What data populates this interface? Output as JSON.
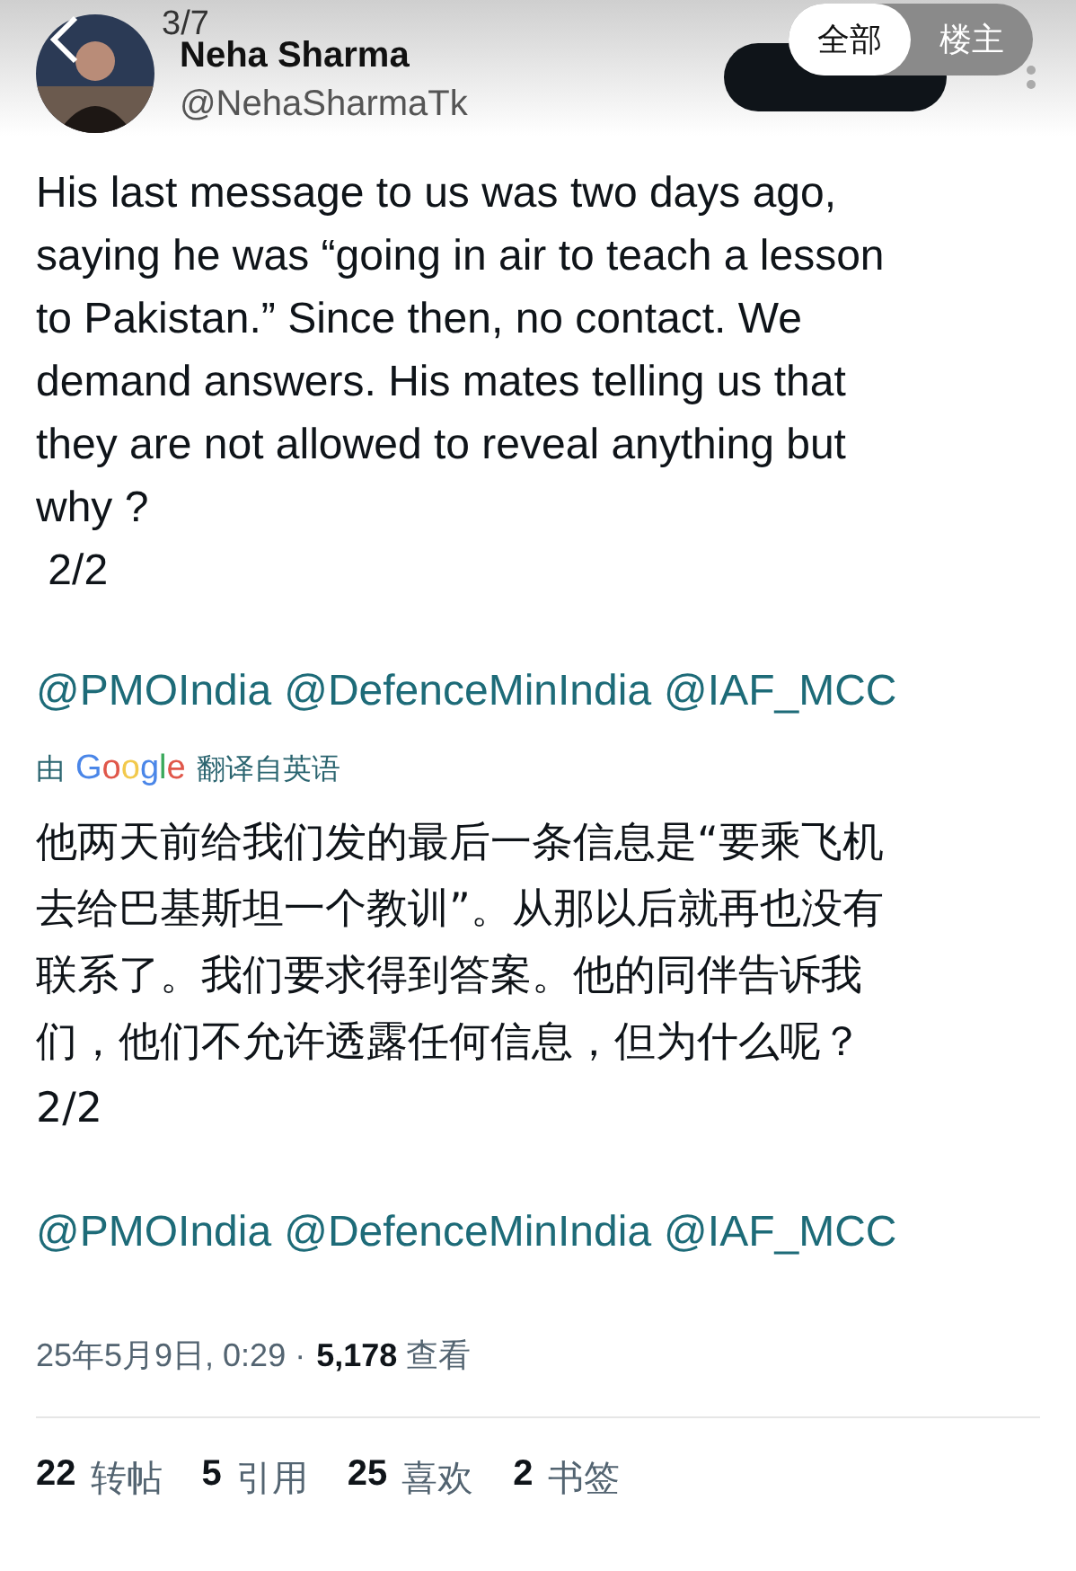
{
  "viewer": {
    "page_counter": "3/7",
    "filter_tabs": [
      {
        "label": "全部",
        "selected": true
      },
      {
        "label": "楼主",
        "selected": false
      }
    ]
  },
  "author": {
    "name": "Neha Sharma",
    "handle": "@NehaSharmaTk"
  },
  "post": {
    "text": "His last message to us was two days ago,\nsaying he was “going in air to teach a lesson\nto Pakistan.” Since then, no contact. We\ndemand answers. His mates telling us that\nthey are not allowed to reveal anything but\nwhy ?\n 2/2",
    "mentions": [
      "@PMOIndia",
      "@DefenceMinIndia",
      "@IAF_MCC"
    ]
  },
  "translation": {
    "prefix": "由",
    "provider": "Google",
    "suffix": "翻译自英语",
    "text": "他两天前给我们发的最后一条信息是“要乘飞机去给巴基斯坦一个教训”。从那以后就再也没有联系了。我们要求得到答案。他的同伴告诉我们，他们不允许透露任何信息，但为什么呢？\n2/2",
    "mentions": [
      "@PMOIndia",
      "@DefenceMinIndia",
      "@IAF_MCC"
    ]
  },
  "meta": {
    "timestamp": "25年5月9日, 0:29 ·",
    "views_count": "5,178",
    "views_label": "查看"
  },
  "stats": [
    {
      "count": "22",
      "label": "转帖"
    },
    {
      "count": "5",
      "label": "引用"
    },
    {
      "count": "25",
      "label": "喜欢"
    },
    {
      "count": "2",
      "label": "书签"
    }
  ]
}
